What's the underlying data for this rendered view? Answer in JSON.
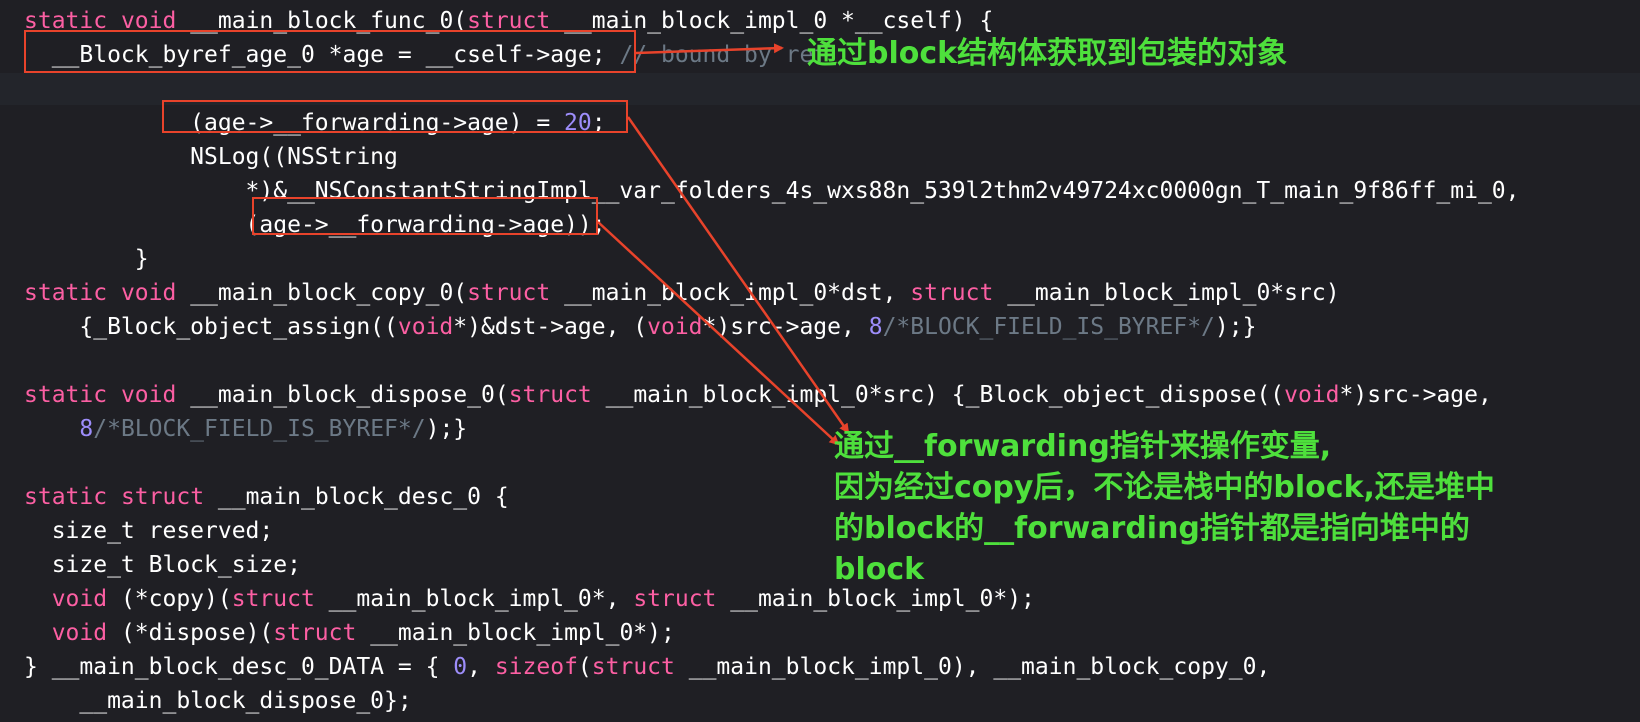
{
  "code_lines": [
    {
      "id": "l1",
      "tokens": [
        {
          "t": "static",
          "k": "kw"
        },
        {
          "t": " ",
          "k": "txt"
        },
        {
          "t": "void",
          "k": "kw"
        },
        {
          "t": " __main_block_func_0(",
          "k": "txt"
        },
        {
          "t": "struct",
          "k": "kw"
        },
        {
          "t": " __main_block_impl_0 *__cself) {",
          "k": "txt"
        }
      ]
    },
    {
      "id": "l2",
      "tokens": [
        {
          "t": "  __Block_byref_age_0 *age = __cself->age; ",
          "k": "txt"
        },
        {
          "t": "// bound by ref",
          "k": "cm"
        }
      ]
    },
    {
      "id": "l3",
      "tokens": []
    },
    {
      "id": "l4",
      "tokens": [
        {
          "t": "            (age->__forwarding->age) = ",
          "k": "txt"
        },
        {
          "t": "20",
          "k": "num"
        },
        {
          "t": ";",
          "k": "txt"
        }
      ]
    },
    {
      "id": "l5",
      "tokens": [
        {
          "t": "            NSLog((NSString",
          "k": "txt"
        }
      ]
    },
    {
      "id": "l6",
      "tokens": [
        {
          "t": "                *)&__NSConstantStringImpl__var_folders_4s_wxs88n_539l2thm2v49724xc0000gn_T_main_9f86ff_mi_0,",
          "k": "txt"
        }
      ]
    },
    {
      "id": "l7",
      "tokens": [
        {
          "t": "                (age->__forwarding->age));",
          "k": "txt"
        }
      ]
    },
    {
      "id": "l8",
      "tokens": [
        {
          "t": "        }",
          "k": "txt"
        }
      ]
    },
    {
      "id": "l9",
      "tokens": [
        {
          "t": "static",
          "k": "kw"
        },
        {
          "t": " ",
          "k": "txt"
        },
        {
          "t": "void",
          "k": "kw"
        },
        {
          "t": " __main_block_copy_0(",
          "k": "txt"
        },
        {
          "t": "struct",
          "k": "kw"
        },
        {
          "t": " __main_block_impl_0*dst, ",
          "k": "txt"
        },
        {
          "t": "struct",
          "k": "kw"
        },
        {
          "t": " __main_block_impl_0*src)",
          "k": "txt"
        }
      ]
    },
    {
      "id": "l10",
      "tokens": [
        {
          "t": "    {_Block_object_assign((",
          "k": "txt"
        },
        {
          "t": "void",
          "k": "kw"
        },
        {
          "t": "*)&dst->age, (",
          "k": "txt"
        },
        {
          "t": "void",
          "k": "kw"
        },
        {
          "t": "*)src->age, ",
          "k": "txt"
        },
        {
          "t": "8",
          "k": "num"
        },
        {
          "t": "/*BLOCK_FIELD_IS_BYREF*/",
          "k": "cm"
        },
        {
          "t": ");}",
          "k": "txt"
        }
      ]
    },
    {
      "id": "l11",
      "tokens": []
    },
    {
      "id": "l12",
      "tokens": [
        {
          "t": "static",
          "k": "kw"
        },
        {
          "t": " ",
          "k": "txt"
        },
        {
          "t": "void",
          "k": "kw"
        },
        {
          "t": " __main_block_dispose_0(",
          "k": "txt"
        },
        {
          "t": "struct",
          "k": "kw"
        },
        {
          "t": " __main_block_impl_0*src) {_Block_object_dispose((",
          "k": "txt"
        },
        {
          "t": "void",
          "k": "kw"
        },
        {
          "t": "*)src->age,",
          "k": "txt"
        }
      ]
    },
    {
      "id": "l13",
      "tokens": [
        {
          "t": "    ",
          "k": "txt"
        },
        {
          "t": "8",
          "k": "num"
        },
        {
          "t": "/*BLOCK_FIELD_IS_BYREF*/",
          "k": "cm"
        },
        {
          "t": ");}",
          "k": "txt"
        }
      ]
    },
    {
      "id": "l14",
      "tokens": []
    },
    {
      "id": "l15",
      "tokens": [
        {
          "t": "static",
          "k": "kw"
        },
        {
          "t": " ",
          "k": "txt"
        },
        {
          "t": "struct",
          "k": "kw"
        },
        {
          "t": " __main_block_desc_0 {",
          "k": "txt"
        }
      ]
    },
    {
      "id": "l16",
      "tokens": [
        {
          "t": "  size_t reserved;",
          "k": "txt"
        }
      ]
    },
    {
      "id": "l17",
      "tokens": [
        {
          "t": "  size_t Block_size;",
          "k": "txt"
        }
      ]
    },
    {
      "id": "l18",
      "tokens": [
        {
          "t": "  ",
          "k": "txt"
        },
        {
          "t": "void",
          "k": "kw"
        },
        {
          "t": " (*copy)(",
          "k": "txt"
        },
        {
          "t": "struct",
          "k": "kw"
        },
        {
          "t": " __main_block_impl_0*, ",
          "k": "txt"
        },
        {
          "t": "struct",
          "k": "kw"
        },
        {
          "t": " __main_block_impl_0*);",
          "k": "txt"
        }
      ]
    },
    {
      "id": "l19",
      "tokens": [
        {
          "t": "  ",
          "k": "txt"
        },
        {
          "t": "void",
          "k": "kw"
        },
        {
          "t": " (*dispose)(",
          "k": "txt"
        },
        {
          "t": "struct",
          "k": "kw"
        },
        {
          "t": " __main_block_impl_0*);",
          "k": "txt"
        }
      ]
    },
    {
      "id": "l20",
      "tokens": [
        {
          "t": "} __main_block_desc_0_DATA = { ",
          "k": "txt"
        },
        {
          "t": "0",
          "k": "num"
        },
        {
          "t": ", ",
          "k": "txt"
        },
        {
          "t": "sizeof",
          "k": "kw"
        },
        {
          "t": "(",
          "k": "txt"
        },
        {
          "t": "struct",
          "k": "kw"
        },
        {
          "t": " __main_block_impl_0), __main_block_copy_0,",
          "k": "txt"
        }
      ]
    },
    {
      "id": "l21",
      "tokens": [
        {
          "t": "    __main_block_dispose_0};",
          "k": "txt"
        }
      ]
    }
  ],
  "annotations": {
    "byref_note": "通过block结构体获取到包装的对象",
    "forwarding_note": "通过__forwarding指针来操作变量,\n因为经过copy后，不论是栈中的block,还是堆中\n的block的__forwarding指针都是指向堆中的\nblock"
  },
  "colors": {
    "background": "#1f1f24",
    "keyword": "#fc5fa3",
    "number": "#9d8dfa",
    "comment": "#6c7986",
    "plain": "#ffffff",
    "annotation": "#4ee03c",
    "markup": "#e8432b"
  }
}
